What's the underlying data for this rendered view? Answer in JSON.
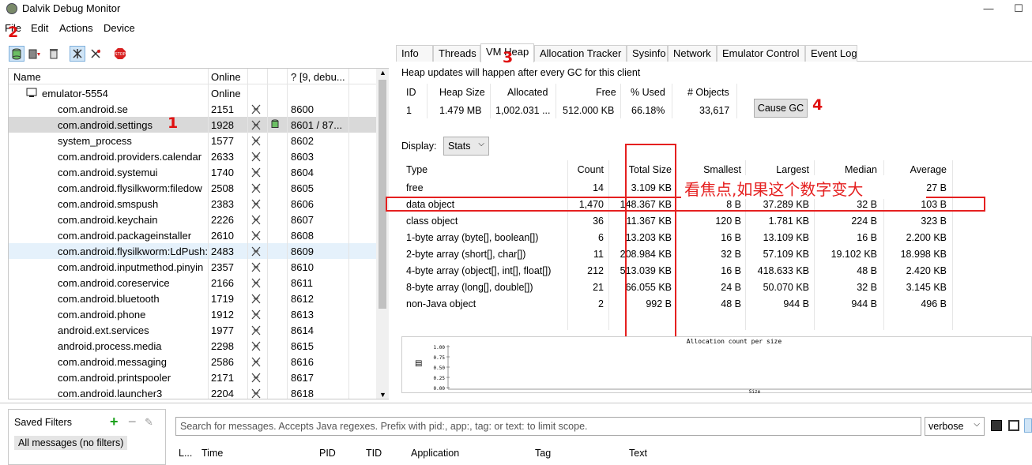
{
  "window": {
    "title": "Dalvik Debug Monitor",
    "minimize": "—",
    "maximize": "☐"
  },
  "menu": [
    "File",
    "Edit",
    "Actions",
    "Device"
  ],
  "annotations": {
    "n1": "1",
    "n2": "2",
    "n3": "3",
    "n4": "4",
    "focus_note": "看焦点,如果这个数字变大"
  },
  "devices": {
    "headers": {
      "name": "Name",
      "online": "Online",
      "port": "? [9, debu..."
    },
    "emulator": {
      "name": "emulator-5554",
      "status": "Online"
    },
    "rows": [
      {
        "name": "com.android.se",
        "pid": "2151",
        "port": "8600"
      },
      {
        "name": "com.android.settings",
        "pid": "1928",
        "port": "8601 / 87..."
      },
      {
        "name": "system_process",
        "pid": "1577",
        "port": "8602"
      },
      {
        "name": "com.android.providers.calendar",
        "pid": "2633",
        "port": "8603"
      },
      {
        "name": "com.android.systemui",
        "pid": "1740",
        "port": "8604"
      },
      {
        "name": "com.android.flysilkworm:filedow",
        "pid": "2508",
        "port": "8605"
      },
      {
        "name": "com.android.smspush",
        "pid": "2383",
        "port": "8606"
      },
      {
        "name": "com.android.keychain",
        "pid": "2226",
        "port": "8607"
      },
      {
        "name": "com.android.packageinstaller",
        "pid": "2610",
        "port": "8608"
      },
      {
        "name": "com.android.flysilkworm:LdPush:",
        "pid": "2483",
        "port": "8609"
      },
      {
        "name": "com.android.inputmethod.pinyin",
        "pid": "2357",
        "port": "8610"
      },
      {
        "name": "com.android.coreservice",
        "pid": "2166",
        "port": "8611"
      },
      {
        "name": "com.android.bluetooth",
        "pid": "1719",
        "port": "8612"
      },
      {
        "name": "com.android.phone",
        "pid": "1912",
        "port": "8613"
      },
      {
        "name": "android.ext.services",
        "pid": "1977",
        "port": "8614"
      },
      {
        "name": "android.process.media",
        "pid": "2298",
        "port": "8615"
      },
      {
        "name": "com.android.messaging",
        "pid": "2586",
        "port": "8616"
      },
      {
        "name": "com.android.printspooler",
        "pid": "2171",
        "port": "8617"
      },
      {
        "name": "com.android.launcher3",
        "pid": "2204",
        "port": "8618"
      }
    ]
  },
  "tabs": [
    "Info",
    "Threads",
    "VM Heap",
    "Allocation Tracker",
    "Sysinfo",
    "Network",
    "Emulator Control",
    "Event Log"
  ],
  "heap": {
    "notice": "Heap updates will happen after every GC for this client",
    "summary_headers": [
      "ID",
      "Heap Size",
      "Allocated",
      "Free",
      "% Used",
      "# Objects"
    ],
    "summary_values": [
      "1",
      "1.479 MB",
      "1,002.031 ...",
      "512.000 KB",
      "66.18%",
      "33,617"
    ],
    "cause_gc": "Cause GC",
    "display_label": "Display:",
    "display_value": "Stats",
    "stats_headers": [
      "Type",
      "Count",
      "Total Size",
      "Smallest",
      "Largest",
      "Median",
      "Average"
    ],
    "stats_rows": [
      [
        "free",
        "14",
        "3.109 KB",
        "",
        "",
        "",
        "227 B"
      ],
      [
        "data object",
        "1,470",
        "148.367 KB",
        "8 B",
        "37.289 KB",
        "32 B",
        "103 B"
      ],
      [
        "class object",
        "36",
        "11.367 KB",
        "120 B",
        "1.781 KB",
        "224 B",
        "323 B"
      ],
      [
        "1-byte array (byte[], boolean[])",
        "6",
        "13.203 KB",
        "16 B",
        "13.109 KB",
        "16 B",
        "2.200 KB"
      ],
      [
        "2-byte array (short[], char[])",
        "11",
        "208.984 KB",
        "32 B",
        "57.109 KB",
        "19.102 KB",
        "18.998 KB"
      ],
      [
        "4-byte array (object[], int[], float[])",
        "212",
        "513.039 KB",
        "16 B",
        "418.633 KB",
        "48 B",
        "2.420 KB"
      ],
      [
        "8-byte array (long[], double[])",
        "21",
        "66.055 KB",
        "24 B",
        "50.070 KB",
        "32 B",
        "3.145 KB"
      ],
      [
        "non-Java object",
        "2",
        "992 B",
        "48 B",
        "944 B",
        "944 B",
        "496 B"
      ]
    ],
    "chart": {
      "title": "Allocation count per size",
      "ticks": [
        "1.00",
        "0.75",
        "0.50",
        "0.25",
        "0.00"
      ],
      "xlabel": "Size"
    }
  },
  "logcat": {
    "saved_filters": "Saved Filters",
    "all_messages": "All messages (no filters)",
    "search_placeholder": "Search for messages. Accepts Java regexes. Prefix with pid:, app:, tag: or text: to limit scope.",
    "level": "verbose",
    "columns": [
      "L...",
      "Time",
      "PID",
      "TID",
      "Application",
      "Tag",
      "Text"
    ]
  }
}
